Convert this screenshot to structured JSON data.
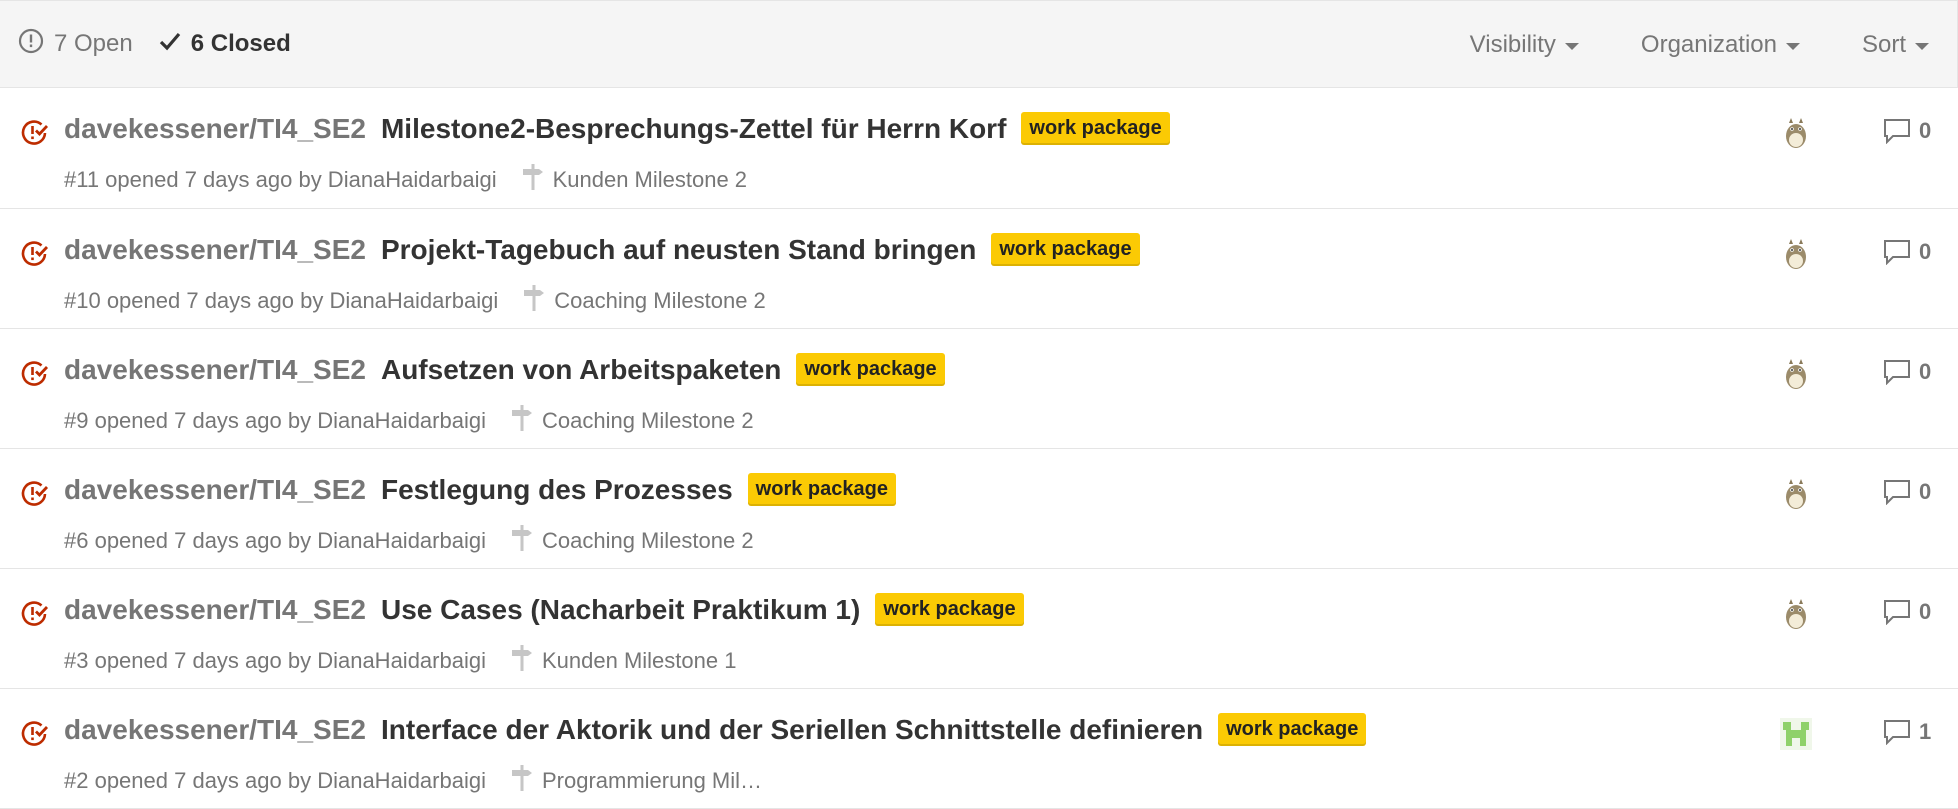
{
  "header": {
    "open_label": "7 Open",
    "closed_label": "6 Closed",
    "filters": {
      "visibility": "Visibility",
      "organization": "Organization",
      "sort": "Sort"
    }
  },
  "issues": [
    {
      "repo": "davekessener/TI4_SE2",
      "title": "Milestone2-Besprechungs-Zettel für Herrn Korf",
      "label": "work package",
      "meta": "#11 opened 7 days ago by DianaHaidarbaigi",
      "milestone": "Kunden Milestone 2",
      "comments": "0",
      "avatar": "totoro"
    },
    {
      "repo": "davekessener/TI4_SE2",
      "title": "Projekt-Tagebuch auf neusten Stand bringen",
      "label": "work package",
      "meta": "#10 opened 7 days ago by DianaHaidarbaigi",
      "milestone": "Coaching Milestone 2",
      "comments": "0",
      "avatar": "totoro"
    },
    {
      "repo": "davekessener/TI4_SE2",
      "title": "Aufsetzen von Arbeitspaketen",
      "label": "work package",
      "meta": "#9 opened 7 days ago by DianaHaidarbaigi",
      "milestone": "Coaching Milestone 2",
      "comments": "0",
      "avatar": "totoro"
    },
    {
      "repo": "davekessener/TI4_SE2",
      "title": "Festlegung des Prozesses",
      "label": "work package",
      "meta": "#6 opened 7 days ago by DianaHaidarbaigi",
      "milestone": "Coaching Milestone 2",
      "comments": "0",
      "avatar": "totoro"
    },
    {
      "repo": "davekessener/TI4_SE2",
      "title": "Use Cases (Nacharbeit Praktikum 1)",
      "label": "work package",
      "meta": "#3 opened 7 days ago by DianaHaidarbaigi",
      "milestone": "Kunden Milestone 1",
      "comments": "0",
      "avatar": "totoro"
    },
    {
      "repo": "davekessener/TI4_SE2",
      "title": "Interface der Aktorik und der Seriellen Schnittstelle definieren",
      "label": "work package",
      "meta": "#2 opened 7 days ago by DianaHaidarbaigi",
      "milestone": "Programmierung Mil…",
      "comments": "1",
      "avatar": "identicon"
    }
  ],
  "colors": {
    "closed_icon": "#bd2c00",
    "label_bg": "#fbca04",
    "muted": "#767676"
  }
}
